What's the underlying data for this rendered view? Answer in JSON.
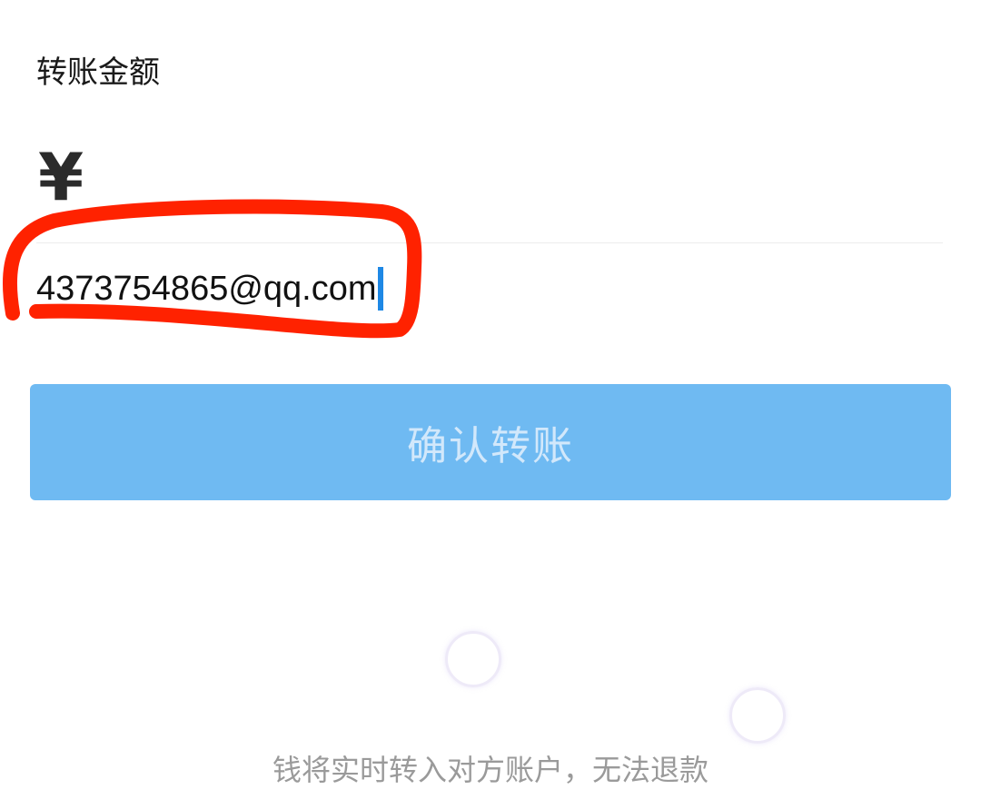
{
  "transfer": {
    "amount_label": "转账金额",
    "currency_symbol": "¥",
    "amount_input_value": "4373754865@qq.com",
    "confirm_button_label": "确认转账",
    "notice": "钱将实时转入对方账户，无法退款"
  },
  "colors": {
    "button_background": "#6fbaf2",
    "button_text": "#d2e8fb",
    "cursor": "#1e88e5",
    "highlight_mark": "#ff2200",
    "notice_text": "#9a9a9a"
  },
  "icons": {
    "loading": "loading-ring-icon"
  }
}
